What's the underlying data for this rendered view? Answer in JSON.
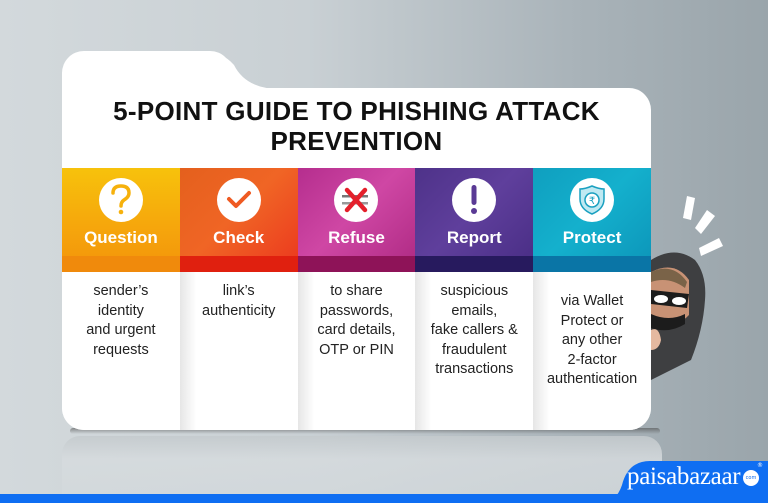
{
  "title": {
    "line1": "5-POINT GUIDE TO PHISHING ATTACK",
    "line2": "PREVENTION"
  },
  "steps": [
    {
      "label": "Question",
      "icon": "question-mark-icon",
      "description": "sender’s\nidentity\nand urgent\nrequests",
      "color": "#f9b20a",
      "strip_color": "#f08a0c"
    },
    {
      "label": "Check",
      "icon": "checkmark-icon",
      "description": "link’s\nauthenticity",
      "color": "#ef5a22",
      "strip_color": "#e0200f"
    },
    {
      "label": "Refuse",
      "icon": "cross-icon",
      "description": "to share\npasswords,\ncard details,\nOTP or PIN",
      "color": "#c2389a",
      "strip_color": "#8e1358"
    },
    {
      "label": "Report",
      "icon": "exclamation-icon",
      "description": "suspicious\nemails,\nfake callers &\nfraudulent\ntransactions",
      "color": "#5a3a95",
      "strip_color": "#271a5e"
    },
    {
      "label": "Protect",
      "icon": "shield-rupee-icon",
      "description": "via Wallet\nProtect or\nany other\n2-factor\nauthentication",
      "color": "#12a9c6",
      "strip_color": "#0a75a6"
    }
  ],
  "brand": {
    "name": "paisabazaar",
    "badge": "com",
    "registered": "®",
    "color": "#0f6ef2"
  }
}
